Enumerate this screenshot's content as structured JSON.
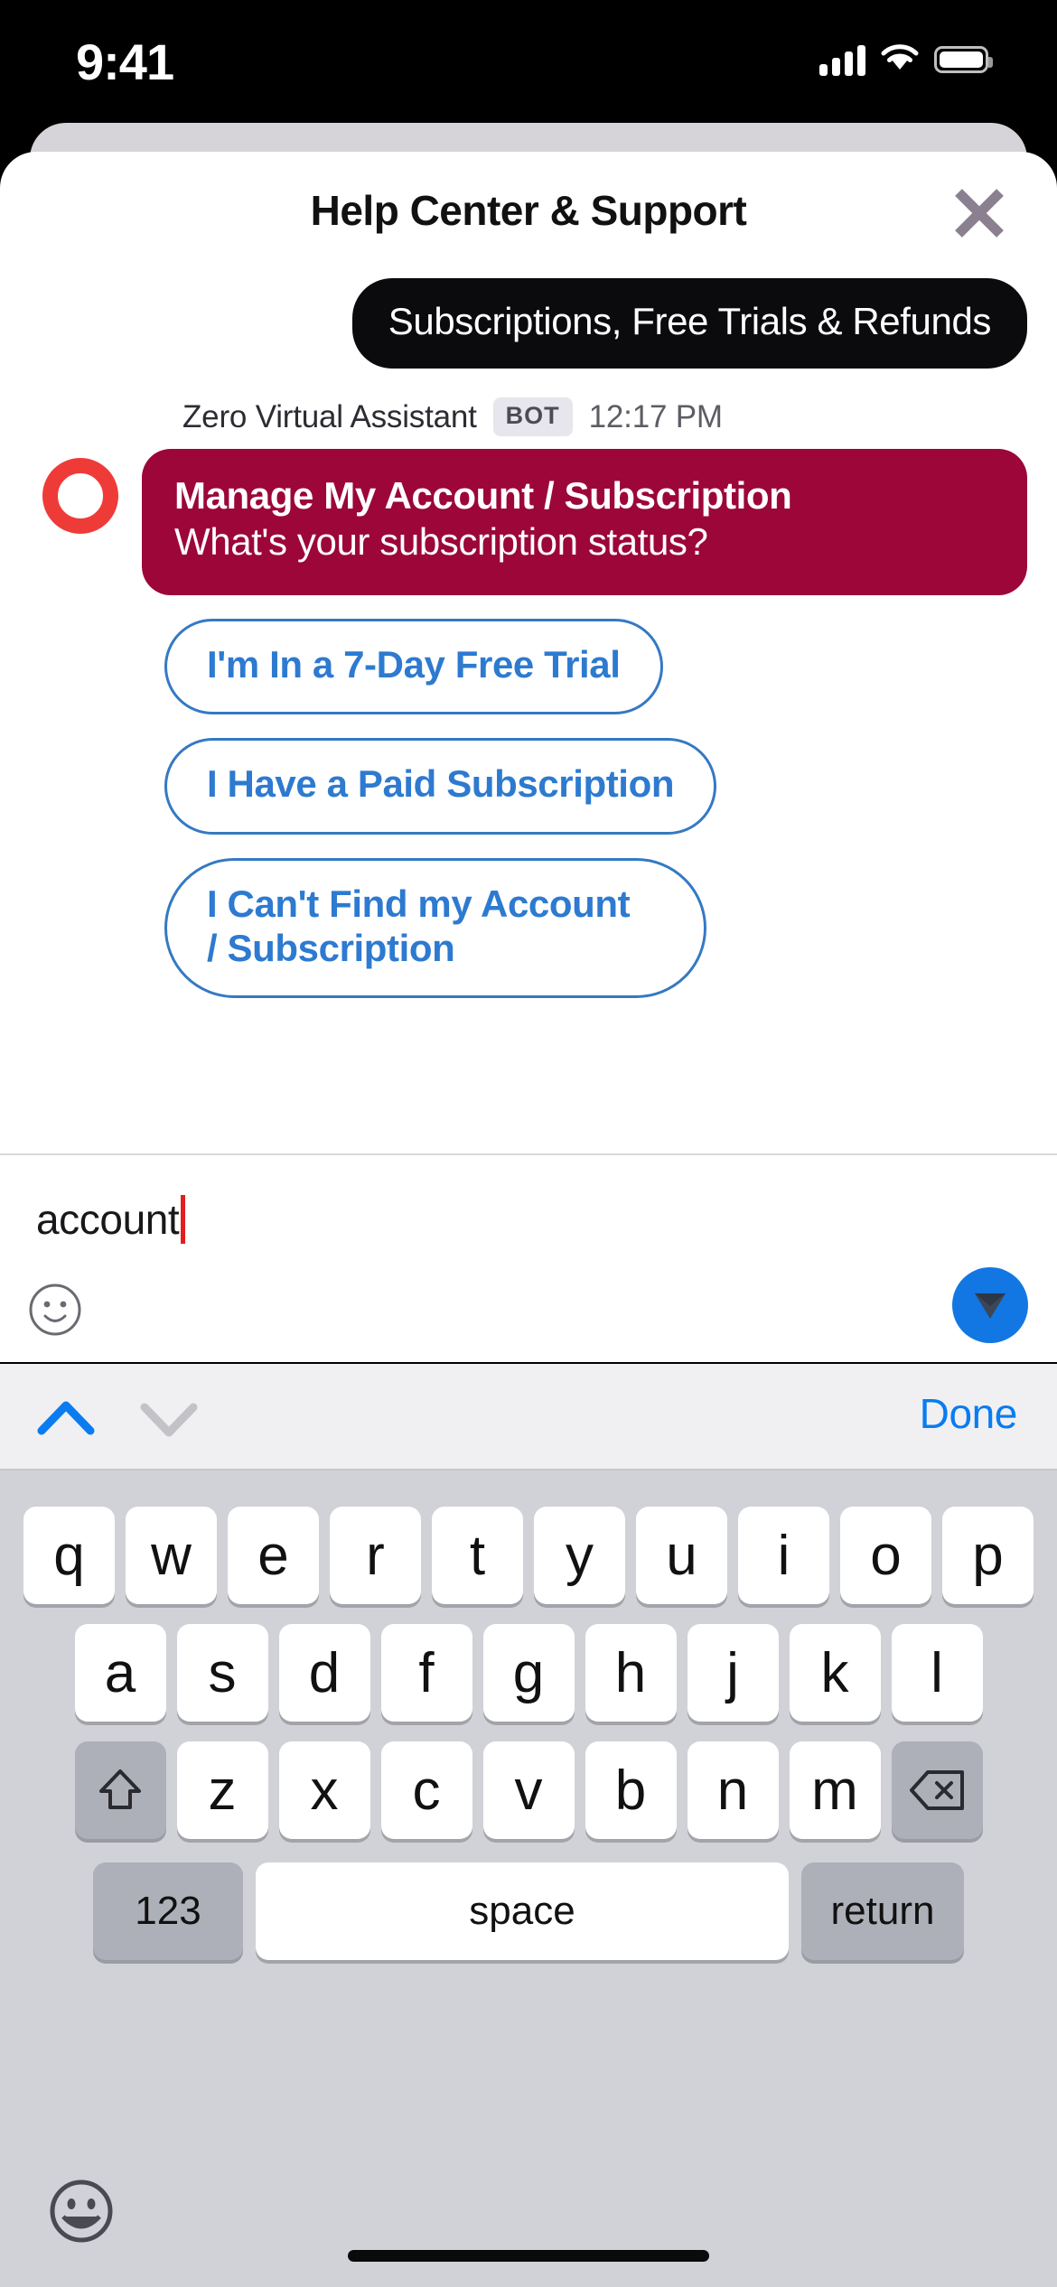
{
  "status_bar": {
    "time": "9:41",
    "signal_icon": "cellular-signal-icon",
    "wifi_icon": "wifi-icon",
    "battery_icon": "battery-icon"
  },
  "sheet": {
    "title": "Help Center & Support",
    "close_icon": "close-icon"
  },
  "chat": {
    "user_message": "Subscriptions, Free Trials & Refunds",
    "bot": {
      "name": "Zero Virtual Assistant",
      "badge": "BOT",
      "time": "12:17 PM",
      "avatar_icon": "bot-avatar-ring-icon",
      "title": "Manage My Account / Subscription",
      "subtitle": "What's your subscription status?"
    },
    "quick_replies": [
      "I'm In a 7-Day Free Trial",
      "I Have a Paid Subscription",
      "I Can't Find my Account / Subscription"
    ]
  },
  "composer": {
    "input_value": "account",
    "emoji_icon": "smiley-face-icon",
    "send_icon": "send-paper-plane-icon"
  },
  "keyboard_toolbar": {
    "prev_icon": "chevron-up-icon",
    "next_icon": "chevron-down-icon",
    "done_label": "Done"
  },
  "keyboard": {
    "row1": [
      "q",
      "w",
      "e",
      "r",
      "t",
      "y",
      "u",
      "i",
      "o",
      "p"
    ],
    "row2": [
      "a",
      "s",
      "d",
      "f",
      "g",
      "h",
      "j",
      "k",
      "l"
    ],
    "row3_letters": [
      "z",
      "x",
      "c",
      "v",
      "b",
      "n",
      "m"
    ],
    "shift_icon": "shift-arrow-icon",
    "backspace_icon": "backspace-delete-icon",
    "numbers_label": "123",
    "space_label": "space",
    "return_label": "return",
    "emoji_switch_icon": "emoji-smiley-globe-icon"
  },
  "colors": {
    "bot_bubble": "#9c0639",
    "user_bubble": "#0b0b0d",
    "accent_blue": "#2d7ad0",
    "send_blue": "#1277e3",
    "avatar_red": "#ef3b38",
    "keyboard_bg": "#d0d2d7"
  }
}
